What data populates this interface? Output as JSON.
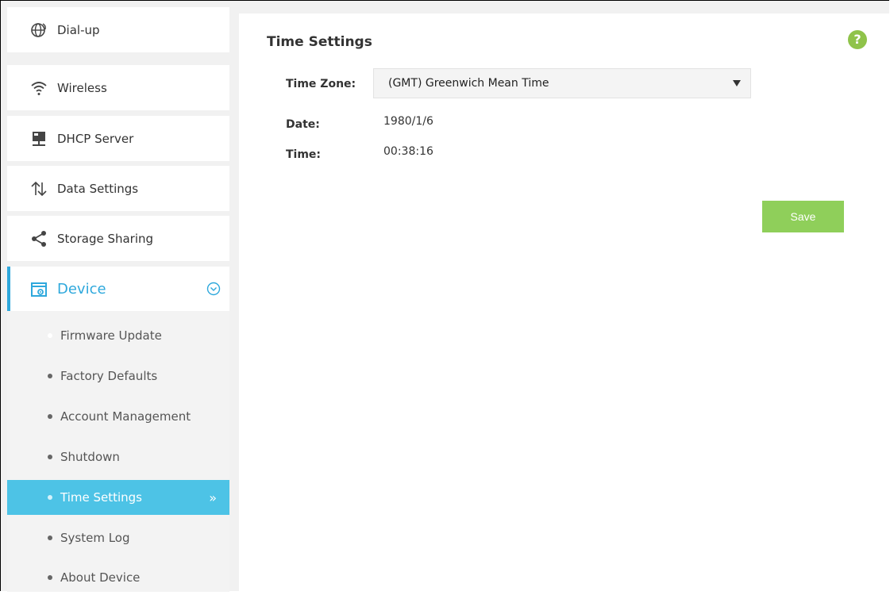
{
  "sidebar": {
    "items": [
      {
        "label": "Dial-up",
        "icon": "globe-icon"
      },
      {
        "label": "Wireless",
        "icon": "wifi-icon"
      },
      {
        "label": "DHCP Server",
        "icon": "server-icon"
      },
      {
        "label": "Data Settings",
        "icon": "arrows-updown-icon"
      },
      {
        "label": "Storage Sharing",
        "icon": "share-icon"
      },
      {
        "label": "Device",
        "icon": "device-settings-icon"
      }
    ],
    "submenu": [
      {
        "label": "Firmware Update"
      },
      {
        "label": "Factory Defaults"
      },
      {
        "label": "Account Management"
      },
      {
        "label": "Shutdown"
      },
      {
        "label": "Time Settings"
      },
      {
        "label": "System Log"
      },
      {
        "label": "About Device"
      }
    ]
  },
  "main": {
    "title": "Time Settings",
    "help_label": "?",
    "time_zone_label": "Time Zone:",
    "time_zone_value": "(GMT) Greenwich Mean Time",
    "date_label": "Date:",
    "date_value": "1980/1/6",
    "time_label": "Time:",
    "time_value": "00:38:16",
    "save_label": "Save"
  },
  "colors": {
    "accent_blue": "#2ea8dc",
    "selected_bg": "#4dc3e6",
    "save_green": "#8fcf5a",
    "help_green": "#8fc34a"
  }
}
